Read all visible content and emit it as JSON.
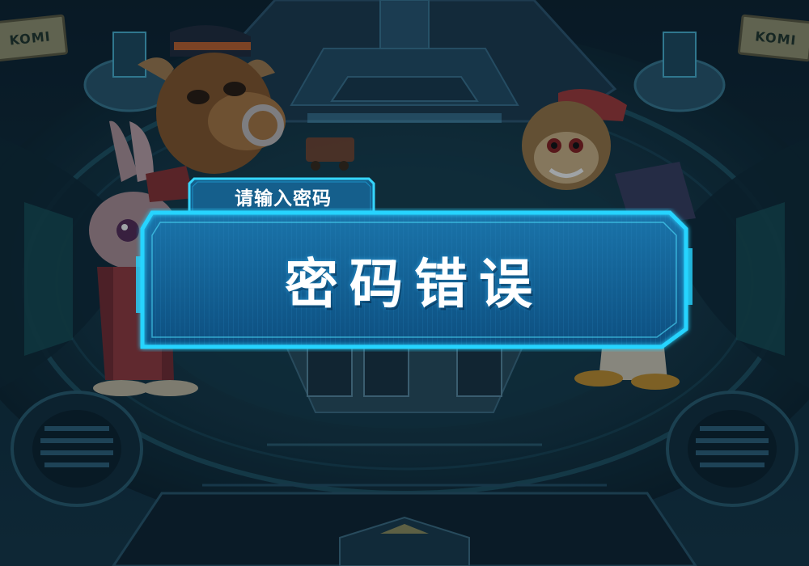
{
  "signs": {
    "left_text": "KOMI",
    "right_text": "KOMI"
  },
  "dialog": {
    "tab_title": "请输入密码",
    "message": "密码错误"
  },
  "colors": {
    "background": "#0b1e2a",
    "panel_fill": "#0f5f93",
    "panel_glow": "#27d4ff",
    "tab_fill": "#155f8c",
    "text": "#ffffff"
  },
  "characters": {
    "left": [
      "rabbit-character",
      "bull-character"
    ],
    "right": [
      "monkey-character"
    ]
  }
}
